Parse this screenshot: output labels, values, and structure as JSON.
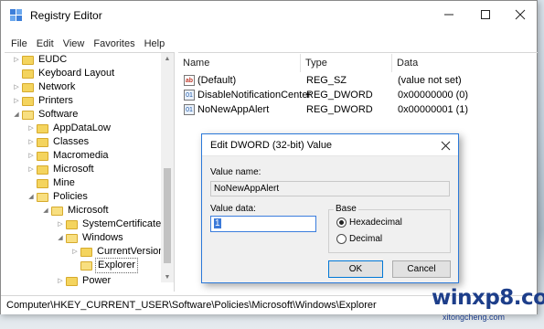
{
  "window": {
    "title": "Registry Editor"
  },
  "menu": [
    "File",
    "Edit",
    "View",
    "Favorites",
    "Help"
  ],
  "tree": [
    {
      "label": "EUDC",
      "arrow": "▷"
    },
    {
      "label": "Keyboard Layout",
      "arrow": ""
    },
    {
      "label": "Network",
      "arrow": "▷"
    },
    {
      "label": "Printers",
      "arrow": "▷"
    },
    {
      "label": "Software",
      "arrow": "◢"
    },
    {
      "label": "AppDataLow",
      "arrow": "▷"
    },
    {
      "label": "Classes",
      "arrow": "▷"
    },
    {
      "label": "Macromedia",
      "arrow": "▷"
    },
    {
      "label": "Microsoft",
      "arrow": "▷"
    },
    {
      "label": "Mine",
      "arrow": ""
    },
    {
      "label": "Policies",
      "arrow": "◢"
    },
    {
      "label": "Microsoft",
      "arrow": "◢"
    },
    {
      "label": "SystemCertificates",
      "arrow": "▷"
    },
    {
      "label": "Windows",
      "arrow": "◢"
    },
    {
      "label": "CurrentVersion",
      "arrow": "▷"
    },
    {
      "label": "Explorer",
      "arrow": ""
    },
    {
      "label": "Power",
      "arrow": "▷"
    }
  ],
  "columns": [
    "Name",
    "Type",
    "Data"
  ],
  "values": [
    {
      "name": "(Default)",
      "type": "REG_SZ",
      "data": "(value not set)",
      "icon": "string-value-icon"
    },
    {
      "name": "DisableNotificationCenter",
      "type": "REG_DWORD",
      "data": "0x00000000 (0)",
      "icon": "dword-value-icon"
    },
    {
      "name": "NoNewAppAlert",
      "type": "REG_DWORD",
      "data": "0x00000001 (1)",
      "icon": "dword-value-icon"
    }
  ],
  "status_path": "Computer\\HKEY_CURRENT_USER\\Software\\Policies\\Microsoft\\Windows\\Explorer",
  "dialog": {
    "title": "Edit DWORD (32-bit) Value",
    "value_name_label": "Value name:",
    "value_name": "NoNewAppAlert",
    "value_data_label": "Value data:",
    "value_data": "1",
    "base_label": "Base",
    "radio_hex": "Hexadecimal",
    "radio_dec": "Decimal",
    "selected_base": "Hexadecimal",
    "ok_label": "OK",
    "cancel_label": "Cancel"
  },
  "watermark": {
    "main": "winxp8.com",
    "sub": "xitongcheng.com"
  },
  "colors": {
    "folder": "#f4d45e",
    "dialog_border": "#2b79d9",
    "selection": "#3b79d8",
    "watermark": "#1d3e8a"
  }
}
